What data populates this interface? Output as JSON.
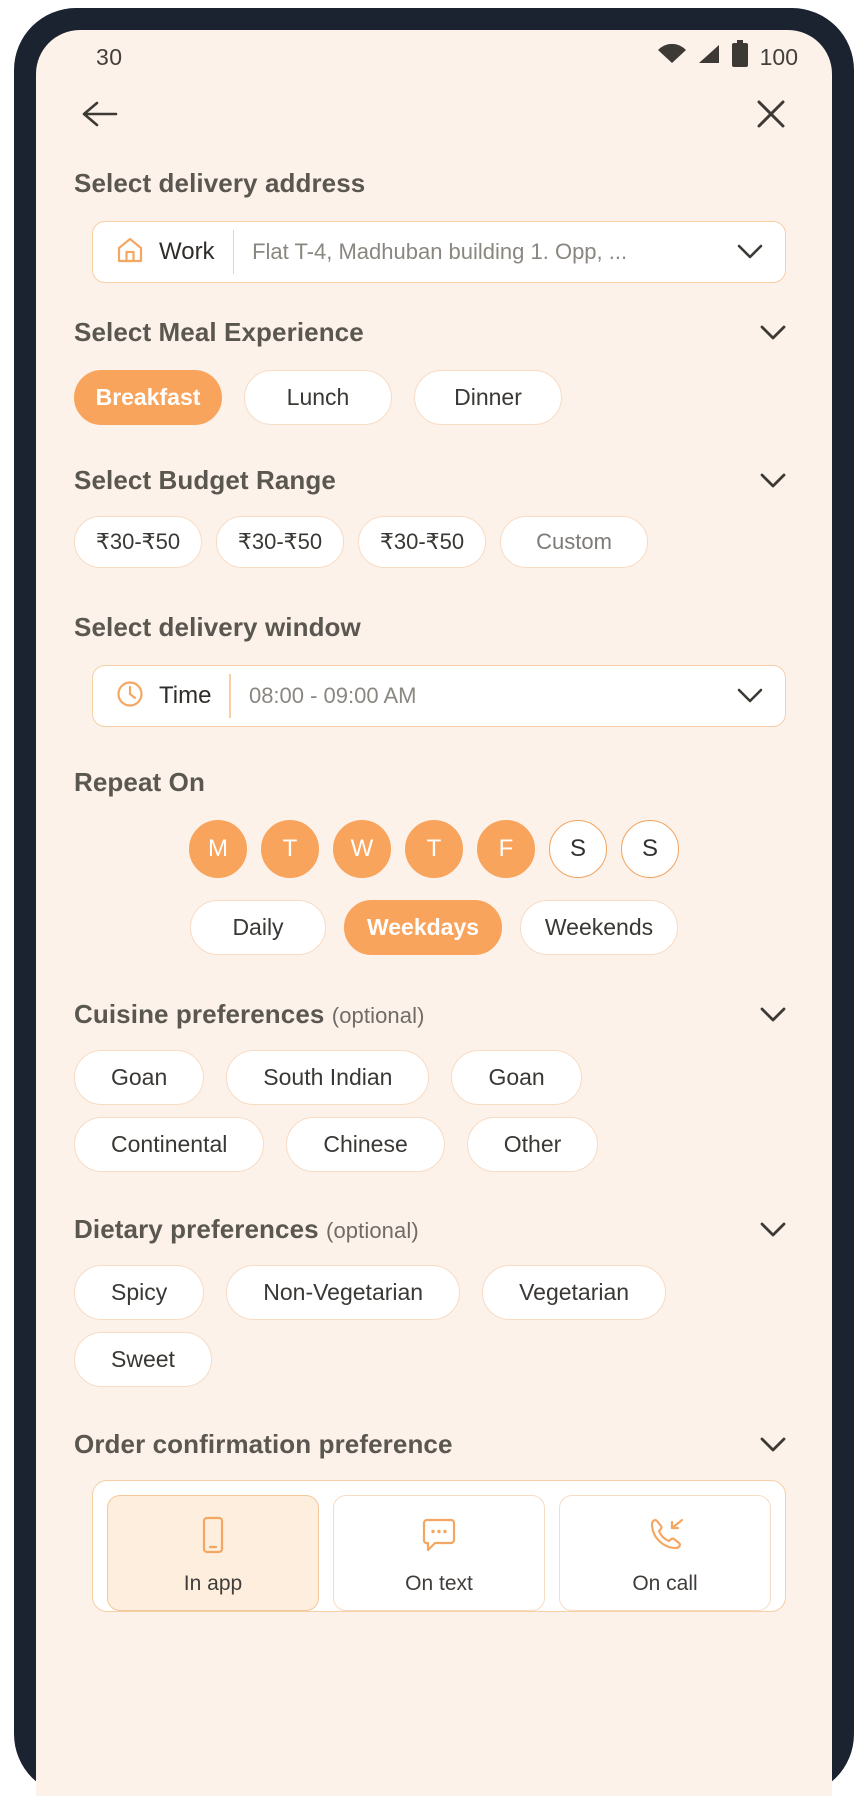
{
  "statusbar": {
    "time": "30",
    "battery": "100"
  },
  "topnav": {
    "back_icon": "arrow-left-icon",
    "close_icon": "close-icon"
  },
  "address": {
    "title": "Select delivery address",
    "tag_icon": "home-icon",
    "tag_label": "Work",
    "value": "Flat T-4, Madhuban building 1. Opp, ...",
    "chevron_icon": "chevron-down-icon"
  },
  "meal": {
    "title": "Select Meal Experience",
    "chevron_icon": "chevron-down-icon",
    "options": [
      {
        "label": "Breakfast",
        "selected": true
      },
      {
        "label": "Lunch",
        "selected": false
      },
      {
        "label": "Dinner",
        "selected": false
      }
    ]
  },
  "budget": {
    "title": "Select Budget Range",
    "chevron_icon": "chevron-down-icon",
    "options": [
      {
        "label": "₹30-₹50",
        "selected": false
      },
      {
        "label": "₹30-₹50",
        "selected": false
      },
      {
        "label": "₹30-₹50",
        "selected": false
      },
      {
        "label": "Custom",
        "selected": false
      }
    ]
  },
  "delivery_window": {
    "title": "Select delivery window",
    "tag_icon": "clock-icon",
    "tag_label": "Time",
    "value": "08:00 - 09:00 AM",
    "chevron_icon": "chevron-down-icon"
  },
  "repeat": {
    "title": "Repeat On",
    "days": [
      {
        "label": "M",
        "selected": true
      },
      {
        "label": "T",
        "selected": true
      },
      {
        "label": "W",
        "selected": true
      },
      {
        "label": "T",
        "selected": true
      },
      {
        "label": "F",
        "selected": true
      },
      {
        "label": "S",
        "selected": false
      },
      {
        "label": "S",
        "selected": false
      }
    ],
    "presets": [
      {
        "label": "Daily",
        "selected": false
      },
      {
        "label": "Weekdays",
        "selected": true
      },
      {
        "label": "Weekends",
        "selected": false
      }
    ]
  },
  "cuisine": {
    "title": "Cuisine preferences",
    "optional": "(optional)",
    "chevron_icon": "chevron-down-icon",
    "options": [
      {
        "label": "Goan"
      },
      {
        "label": "South Indian"
      },
      {
        "label": "Goan"
      },
      {
        "label": "Continental"
      },
      {
        "label": "Chinese"
      },
      {
        "label": "Other"
      }
    ]
  },
  "dietary": {
    "title": "Dietary preferences",
    "optional": "(optional)",
    "chevron_icon": "chevron-down-icon",
    "options": [
      {
        "label": "Spicy"
      },
      {
        "label": "Non-Vegetarian"
      },
      {
        "label": "Vegetarian"
      },
      {
        "label": "Sweet"
      }
    ]
  },
  "confirmation": {
    "title": "Order confirmation preference",
    "chevron_icon": "chevron-down-icon",
    "options": [
      {
        "label": "In app",
        "icon": "mobile-phone-icon",
        "selected": true
      },
      {
        "label": "On text",
        "icon": "chat-bubble-icon",
        "selected": false
      },
      {
        "label": "On call",
        "icon": "phone-callback-icon",
        "selected": false
      }
    ]
  },
  "colors": {
    "accent": "#f9a45c",
    "accent_border": "#f6cfa6",
    "background": "#fdf2ea",
    "card": "#ffffff",
    "heading": "#5a5751",
    "frame": "#1c2330"
  }
}
